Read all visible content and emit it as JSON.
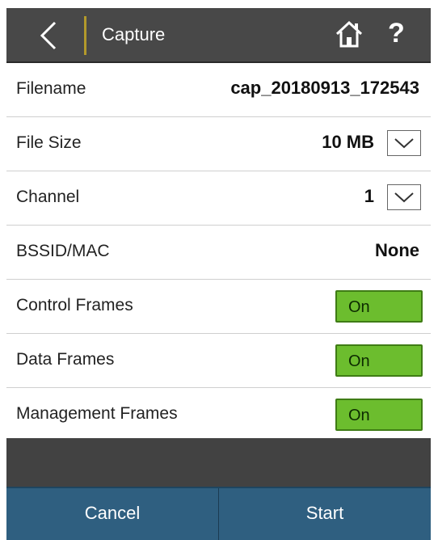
{
  "header": {
    "title": "Capture",
    "help_label": "?"
  },
  "rows": {
    "filename": {
      "label": "Filename",
      "value": "cap_20180913_172543"
    },
    "file_size": {
      "label": "File Size",
      "value": "10 MB"
    },
    "channel": {
      "label": "Channel",
      "value": "1"
    },
    "bssid": {
      "label": "BSSID/MAC",
      "value": "None"
    },
    "control": {
      "label": "Control Frames",
      "toggle": "On"
    },
    "data": {
      "label": "Data Frames",
      "toggle": "On"
    },
    "management": {
      "label": "Management Frames",
      "toggle": "On"
    }
  },
  "footer": {
    "cancel": "Cancel",
    "start": "Start"
  },
  "colors": {
    "header_bg": "#484848",
    "toggle_on": "#6cbd2e",
    "footer_bg": "#2f5f80",
    "separator_accent": "#b39a2b"
  }
}
